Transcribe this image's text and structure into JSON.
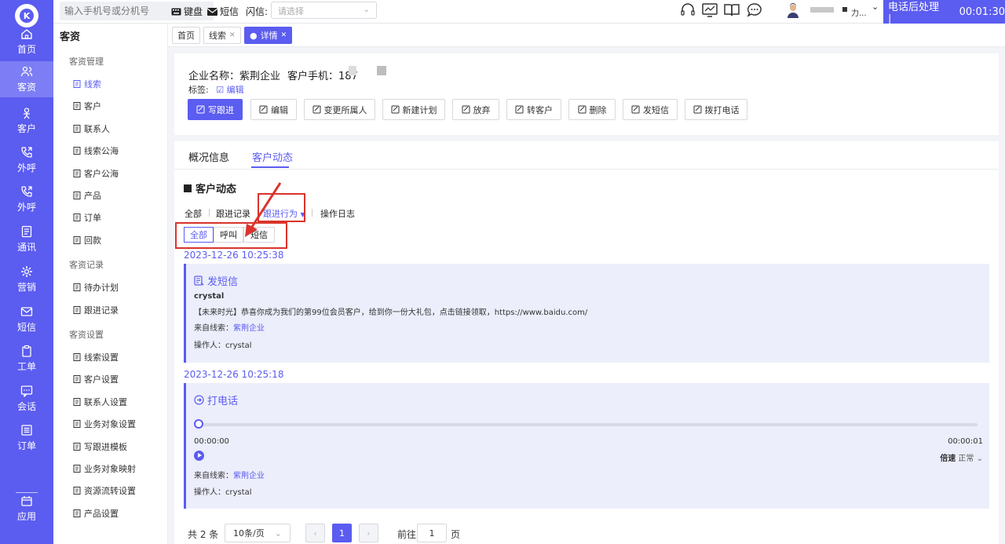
{
  "nav": {
    "items": [
      {
        "label": "首页",
        "icon": "home-icon"
      },
      {
        "label": "客资",
        "icon": "users-icon"
      },
      {
        "label": "客户",
        "icon": "person-icon"
      },
      {
        "label": "外呼",
        "icon": "phone-out-icon"
      },
      {
        "label": "外呼",
        "icon": "phone-out-icon"
      },
      {
        "label": "通讯",
        "icon": "contacts-icon"
      },
      {
        "label": "营销",
        "icon": "gear-icon"
      },
      {
        "label": "短信",
        "icon": "message-icon"
      },
      {
        "label": "工单",
        "icon": "clipboard-icon"
      },
      {
        "label": "会话",
        "icon": "chat-icon"
      },
      {
        "label": "订单",
        "icon": "list-icon"
      },
      {
        "label": "应用",
        "icon": "app-icon"
      }
    ],
    "active_index": 1
  },
  "topbar": {
    "phone_placeholder": "输入手机号或分机号",
    "keyboard_label": "键盘",
    "sms_label": "短信",
    "flash_label": "闪信:",
    "flash_placeholder": "请选择",
    "user_name": "力...",
    "after_call_label": "电话后处理 |",
    "timer": "00:01:30"
  },
  "sidebar": {
    "title": "客资",
    "groups": [
      {
        "label": "客资管理",
        "items": [
          "线索",
          "客户",
          "联系人",
          "线索公海",
          "客户公海",
          "产品",
          "订单",
          "回款"
        ]
      },
      {
        "label": "客资记录",
        "items": [
          "待办计划",
          "跟进记录"
        ]
      },
      {
        "label": "客资设置",
        "items": [
          "线索设置",
          "客户设置",
          "联系人设置",
          "业务对象设置",
          "写跟进模板",
          "业务对象映射",
          "资源流转设置",
          "产品设置"
        ]
      }
    ],
    "active_item": "线索"
  },
  "page_tabs": [
    {
      "label": "首页",
      "closable": false
    },
    {
      "label": "线索",
      "closable": true
    },
    {
      "label": "详情",
      "closable": true
    }
  ],
  "header": {
    "company_label": "企业名称：紫荆企业",
    "phone_label": "客户手机：187",
    "tags_label": "标签:",
    "edit_tags_label": "编辑",
    "actions": [
      "写跟进",
      "编辑",
      "变更所属人",
      "新建计划",
      "放弃",
      "转客户",
      "删除",
      "发短信",
      "拨打电话"
    ]
  },
  "main": {
    "tabs": [
      "概况信息",
      "客户动态"
    ],
    "active_tab": "客户动态",
    "section_title": "客户动态",
    "filters": [
      "全部",
      "跟进记录",
      "跟进行为",
      "操作日志"
    ],
    "active_filter": "跟进行为",
    "sub_filters": [
      "全部",
      "呼叫",
      "短信"
    ],
    "active_sub_filter": "全部",
    "events": [
      {
        "timestamp": "2023-12-26 10:25:38",
        "title": "发短信",
        "sender": "crystal",
        "content": "【未来时光】恭喜你成为我们的第99位会员客户，给到你一份大礼包，点击链接领取，https://www.baidu.com/",
        "source_label": "来自线索：",
        "source_value": "紫荆企业",
        "operator_label": "操作人：crystal"
      },
      {
        "timestamp": "2023-12-26 10:25:18",
        "title": "打电话",
        "time_start": "00:00:00",
        "time_end": "00:00:01",
        "speed_label": "倍速",
        "speed_value": "正常",
        "progress": 0,
        "source_label": "来自线索：",
        "source_value": "紫荆企业",
        "operator_label": "操作人：crystal"
      }
    ]
  },
  "pagination": {
    "total_label": "共 2 条",
    "page_size": "10条/页",
    "current_page": "1",
    "goto_label": "前往",
    "goto_value": "1",
    "page_suffix": "页"
  },
  "colors": {
    "primary": "#5b5cf0",
    "annotation_red": "#d9342b"
  }
}
